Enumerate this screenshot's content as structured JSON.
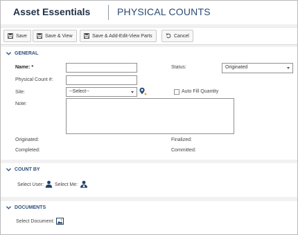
{
  "header": {
    "app_title": "Asset Essentials",
    "page_title": "PHYSICAL COUNTS"
  },
  "toolbar": {
    "save_label": "Save",
    "save_view_label": "Save & View",
    "save_add_label": "Save & Add-Edit-View Parts",
    "cancel_label": "Cancel"
  },
  "general": {
    "title": "GENERAL",
    "name_label": "Name: *",
    "name_value": "",
    "physical_count_label": "Physical Count #:",
    "physical_count_value": "",
    "site_label": "Site:",
    "site_value": "--Select--",
    "note_label": "Note:",
    "note_value": "",
    "status_label": "Status:",
    "status_value": "Originated",
    "auto_fill_label": "Auto Fill Quantity",
    "auto_fill_checked": false,
    "originated_label": "Originated:",
    "completed_label": "Completed:",
    "finalized_label": "Finalized:",
    "committed_label": "Committed:"
  },
  "count_by": {
    "title": "COUNT BY",
    "select_user_label": "Select User:",
    "select_me_label": "Select Me:"
  },
  "documents": {
    "title": "DOCUMENTS",
    "select_document_label": "Select Document:"
  },
  "colors": {
    "accent": "#2c4f7c",
    "brand": "#1f2f45"
  },
  "icons": [
    "save-icon",
    "undo-icon",
    "chevron-down-icon",
    "map-pin-icon",
    "user-icon",
    "user-select-icon",
    "image-icon"
  ]
}
